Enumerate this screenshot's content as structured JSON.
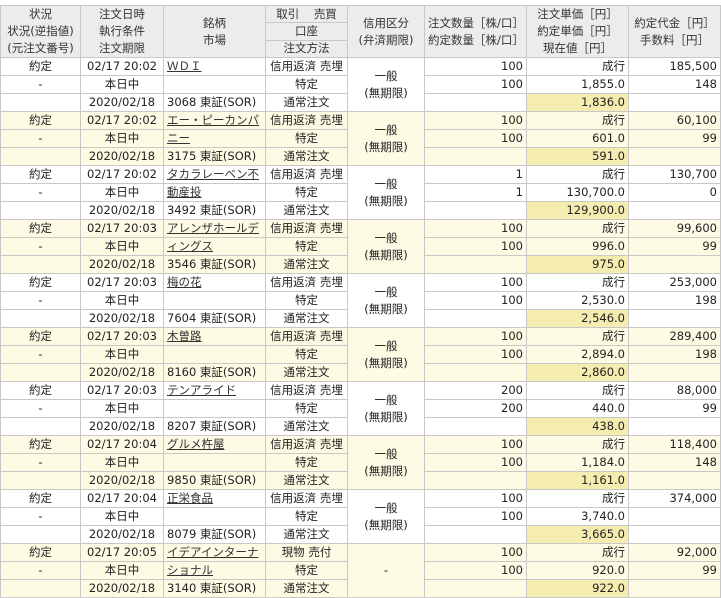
{
  "header": {
    "col1": [
      "状況",
      "状況(逆指値)",
      "(元注文番号)"
    ],
    "col2": [
      "注文日時",
      "執行条件",
      "注文期限"
    ],
    "col3": [
      "銘柄",
      "市場"
    ],
    "col4a": "取引",
    "col4b": "売買",
    "col4c": "口座",
    "col4d": "注文方法",
    "col5": [
      "信用区分",
      "(弁済期限)"
    ],
    "col6": [
      "注文数量［株/口］",
      "約定数量［株/口］"
    ],
    "col7": [
      "注文単価［円］",
      "約定単価［円］",
      "現在値［円］"
    ],
    "col8": [
      "約定代金［円］",
      "手数料［円］"
    ]
  },
  "orders": [
    {
      "status": "約定",
      "status2": "-",
      "datetime": "02/17 20:02",
      "cond": "本日中",
      "expiry": "2020/02/18",
      "name": [
        "ＷＤＩ"
      ],
      "market": "3068 東証(SOR)",
      "trade": "信用返済",
      "side": "売埋",
      "account": "特定",
      "method": "通常注文",
      "credit": "一般",
      "credit2": "(無期限)",
      "qty": "100",
      "fill_qty": "100",
      "order_price": "成行",
      "fill_price": "1,855.0",
      "current": "1,836.0",
      "amount": "185,500",
      "fee": "148"
    },
    {
      "status": "約定",
      "status2": "-",
      "datetime": "02/17 20:02",
      "cond": "本日中",
      "expiry": "2020/02/18",
      "name": [
        "エー・ピーカンパ",
        "ニー"
      ],
      "market": "3175 東証(SOR)",
      "trade": "信用返済",
      "side": "売埋",
      "account": "特定",
      "method": "通常注文",
      "credit": "一般",
      "credit2": "(無期限)",
      "qty": "100",
      "fill_qty": "100",
      "order_price": "成行",
      "fill_price": "601.0",
      "current": "591.0",
      "amount": "60,100",
      "fee": "99"
    },
    {
      "status": "約定",
      "status2": "-",
      "datetime": "02/17 20:02",
      "cond": "本日中",
      "expiry": "2020/02/18",
      "name": [
        "タカラレーベン不",
        "動産投"
      ],
      "market": "3492 東証(SOR)",
      "trade": "信用返済",
      "side": "売埋",
      "account": "特定",
      "method": "通常注文",
      "credit": "一般",
      "credit2": "(無期限)",
      "qty": "1",
      "fill_qty": "1",
      "order_price": "成行",
      "fill_price": "130,700.0",
      "current": "129,900.0",
      "amount": "130,700",
      "fee": "0"
    },
    {
      "status": "約定",
      "status2": "-",
      "datetime": "02/17 20:03",
      "cond": "本日中",
      "expiry": "2020/02/18",
      "name": [
        "アレンザホールデ",
        "ィングス"
      ],
      "market": "3546 東証(SOR)",
      "trade": "信用返済",
      "side": "売埋",
      "account": "特定",
      "method": "通常注文",
      "credit": "一般",
      "credit2": "(無期限)",
      "qty": "100",
      "fill_qty": "100",
      "order_price": "成行",
      "fill_price": "996.0",
      "current": "975.0",
      "amount": "99,600",
      "fee": "99"
    },
    {
      "status": "約定",
      "status2": "-",
      "datetime": "02/17 20:03",
      "cond": "本日中",
      "expiry": "2020/02/18",
      "name": [
        "梅の花"
      ],
      "market": "7604 東証(SOR)",
      "trade": "信用返済",
      "side": "売埋",
      "account": "特定",
      "method": "通常注文",
      "credit": "一般",
      "credit2": "(無期限)",
      "qty": "100",
      "fill_qty": "100",
      "order_price": "成行",
      "fill_price": "2,530.0",
      "current": "2,546.0",
      "amount": "253,000",
      "fee": "198"
    },
    {
      "status": "約定",
      "status2": "-",
      "datetime": "02/17 20:03",
      "cond": "本日中",
      "expiry": "2020/02/18",
      "name": [
        "木曽路"
      ],
      "market": "8160 東証(SOR)",
      "trade": "信用返済",
      "side": "売埋",
      "account": "特定",
      "method": "通常注文",
      "credit": "一般",
      "credit2": "(無期限)",
      "qty": "100",
      "fill_qty": "100",
      "order_price": "成行",
      "fill_price": "2,894.0",
      "current": "2,860.0",
      "amount": "289,400",
      "fee": "198"
    },
    {
      "status": "約定",
      "status2": "-",
      "datetime": "02/17 20:03",
      "cond": "本日中",
      "expiry": "2020/02/18",
      "name": [
        "テンアライド"
      ],
      "market": "8207 東証(SOR)",
      "trade": "信用返済",
      "side": "売埋",
      "account": "特定",
      "method": "通常注文",
      "credit": "一般",
      "credit2": "(無期限)",
      "qty": "200",
      "fill_qty": "200",
      "order_price": "成行",
      "fill_price": "440.0",
      "current": "438.0",
      "amount": "88,000",
      "fee": "99"
    },
    {
      "status": "約定",
      "status2": "-",
      "datetime": "02/17 20:04",
      "cond": "本日中",
      "expiry": "2020/02/18",
      "name": [
        "グルメ杵屋"
      ],
      "market": "9850 東証(SOR)",
      "trade": "信用返済",
      "side": "売埋",
      "account": "特定",
      "method": "通常注文",
      "credit": "一般",
      "credit2": "(無期限)",
      "qty": "100",
      "fill_qty": "100",
      "order_price": "成行",
      "fill_price": "1,184.0",
      "current": "1,161.0",
      "amount": "118,400",
      "fee": "148"
    },
    {
      "status": "約定",
      "status2": "-",
      "datetime": "02/17 20:04",
      "cond": "本日中",
      "expiry": "2020/02/18",
      "name": [
        "正栄食品"
      ],
      "market": "8079 東証(SOR)",
      "trade": "信用返済",
      "side": "売埋",
      "account": "特定",
      "method": "通常注文",
      "credit": "一般",
      "credit2": "(無期限)",
      "qty": "100",
      "fill_qty": "100",
      "order_price": "成行",
      "fill_price": "3,740.0",
      "current": "3,665.0",
      "amount": "374,000",
      "fee": ""
    },
    {
      "status": "約定",
      "status2": "-",
      "datetime": "02/17 20:05",
      "cond": "本日中",
      "expiry": "2020/02/18",
      "name": [
        "イデアインターナ",
        "ショナル"
      ],
      "market": "3140 東証(SOR)",
      "trade": "現物",
      "side": "売付",
      "account": "特定",
      "method": "通常注文",
      "credit": "-",
      "credit2": "",
      "qty": "100",
      "fill_qty": "100",
      "order_price": "成行",
      "fill_price": "920.0",
      "current": "922.0",
      "amount": "92,000",
      "fee": "99"
    }
  ],
  "colors": {
    "row_alt": "#fdfbe4",
    "highlight": "#f5ecb0",
    "header_bg": "#ececec",
    "border": "#c8c8c8"
  }
}
